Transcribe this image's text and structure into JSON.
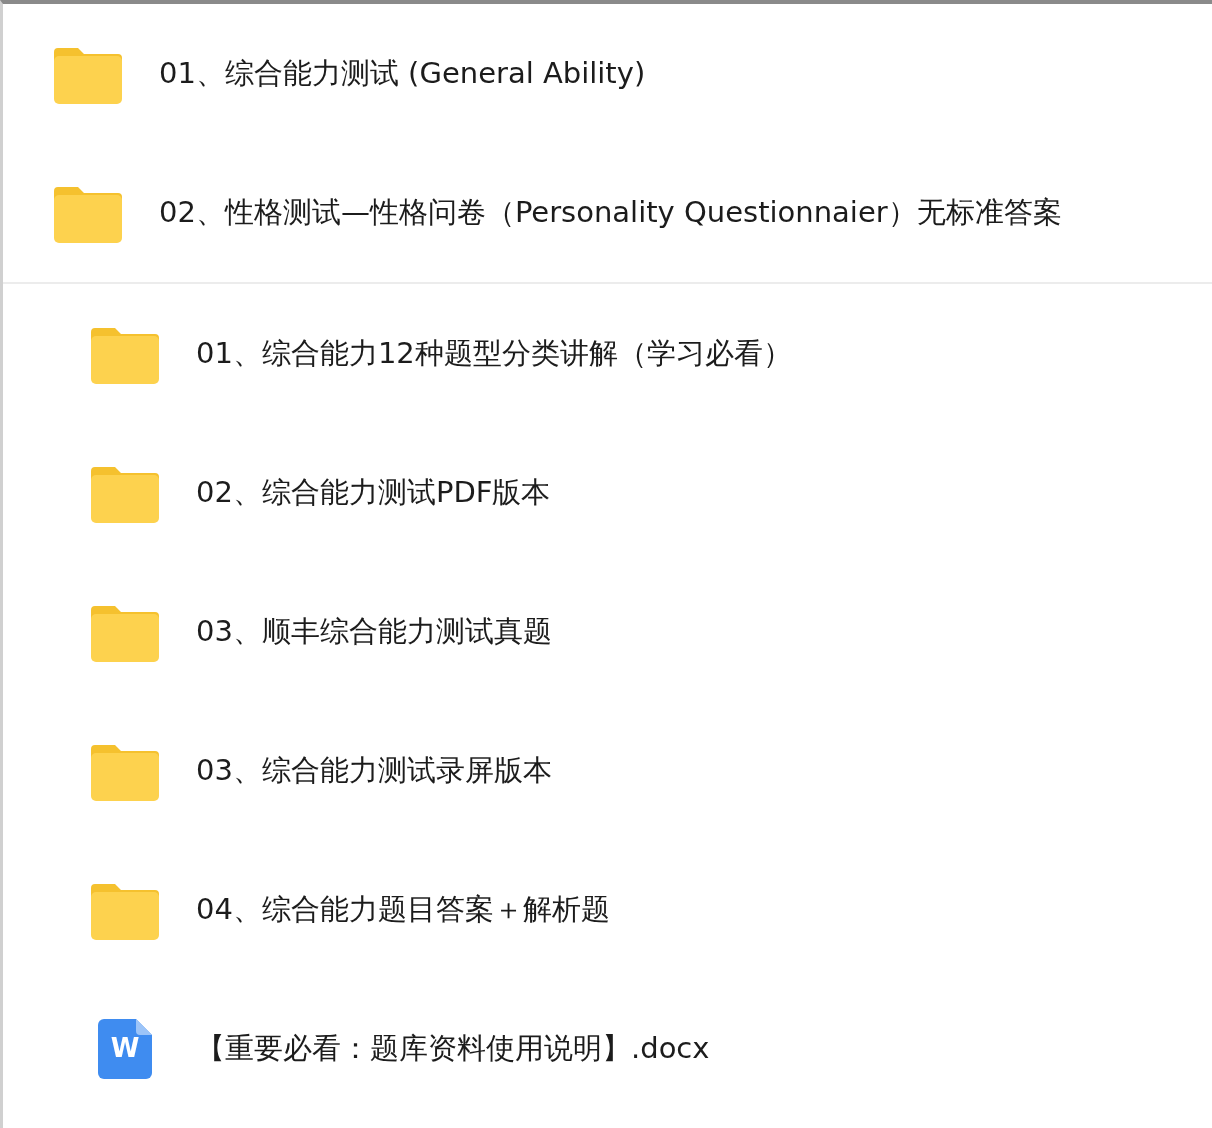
{
  "groups": [
    {
      "items": [
        {
          "kind": "folder",
          "name": "01、综合能力测试 (General Ability)"
        },
        {
          "kind": "folder",
          "name": "02、性格测试—性格问卷（Personality Questionnaier）无标准答案"
        }
      ]
    },
    {
      "items": [
        {
          "kind": "folder",
          "name": "01、综合能力12种题型分类讲解（学习必看）"
        },
        {
          "kind": "folder",
          "name": "02、综合能力测试PDF版本"
        },
        {
          "kind": "folder",
          "name": "03、顺丰综合能力测试真题"
        },
        {
          "kind": "folder",
          "name": "03、综合能力测试录屏版本"
        },
        {
          "kind": "folder",
          "name": "04、综合能力题目答案＋解析题"
        },
        {
          "kind": "docx",
          "icon_letter": "W",
          "name": "【重要必看：题库资料使用说明】.docx"
        }
      ]
    }
  ]
}
